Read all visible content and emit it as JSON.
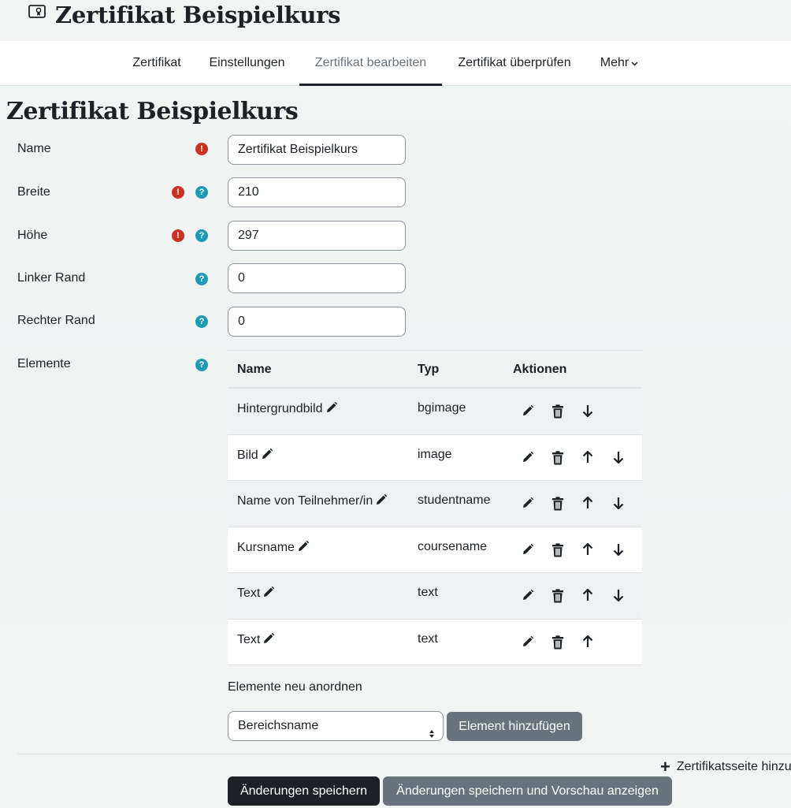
{
  "header": {
    "title": "Zertifikat Beispielkurs",
    "icon": "certificate-icon"
  },
  "nav": {
    "tabs": [
      {
        "label": "Zertifikat"
      },
      {
        "label": "Einstellungen"
      },
      {
        "label": "Zertifikat bearbeiten",
        "active": true
      },
      {
        "label": "Zertifikat überprüfen"
      },
      {
        "label": "Mehr"
      }
    ]
  },
  "main": {
    "title": "Zertifikat Beispielkurs"
  },
  "form": {
    "name": {
      "label": "Name",
      "value": "Zertifikat Beispielkurs"
    },
    "width": {
      "label": "Breite",
      "value": "210"
    },
    "height": {
      "label": "Höhe",
      "value": "297"
    },
    "left_margin": {
      "label": "Linker Rand",
      "value": "0"
    },
    "right_margin": {
      "label": "Rechter Rand",
      "value": "0"
    },
    "elements_label": "Elemente"
  },
  "table": {
    "headers": {
      "name": "Name",
      "type": "Typ",
      "actions": "Aktionen"
    },
    "rows": [
      {
        "name": "Hintergrundbild",
        "type": "bgimage"
      },
      {
        "name": "Bild",
        "type": "image"
      },
      {
        "name": "Name von Teilnehmer/in",
        "type": "studentname"
      },
      {
        "name": "Kursname",
        "type": "coursename"
      },
      {
        "name": "Text",
        "type": "text"
      },
      {
        "name": "Text",
        "type": "text"
      }
    ]
  },
  "reorder": {
    "label": "Elemente neu anordnen",
    "select_value": "Bereichsname",
    "add_button": "Element hinzufügen"
  },
  "footer": {
    "add_page": "Zertifikatsseite hinzufügen",
    "save": "Änderungen speichern",
    "save_preview": "Änderungen speichern und Vorschau anzeigen"
  },
  "colors": {
    "required": "#ca3120",
    "help": "#1f9ab5",
    "dark_button": "#1d2125",
    "secondary_button": "#6a737b"
  }
}
